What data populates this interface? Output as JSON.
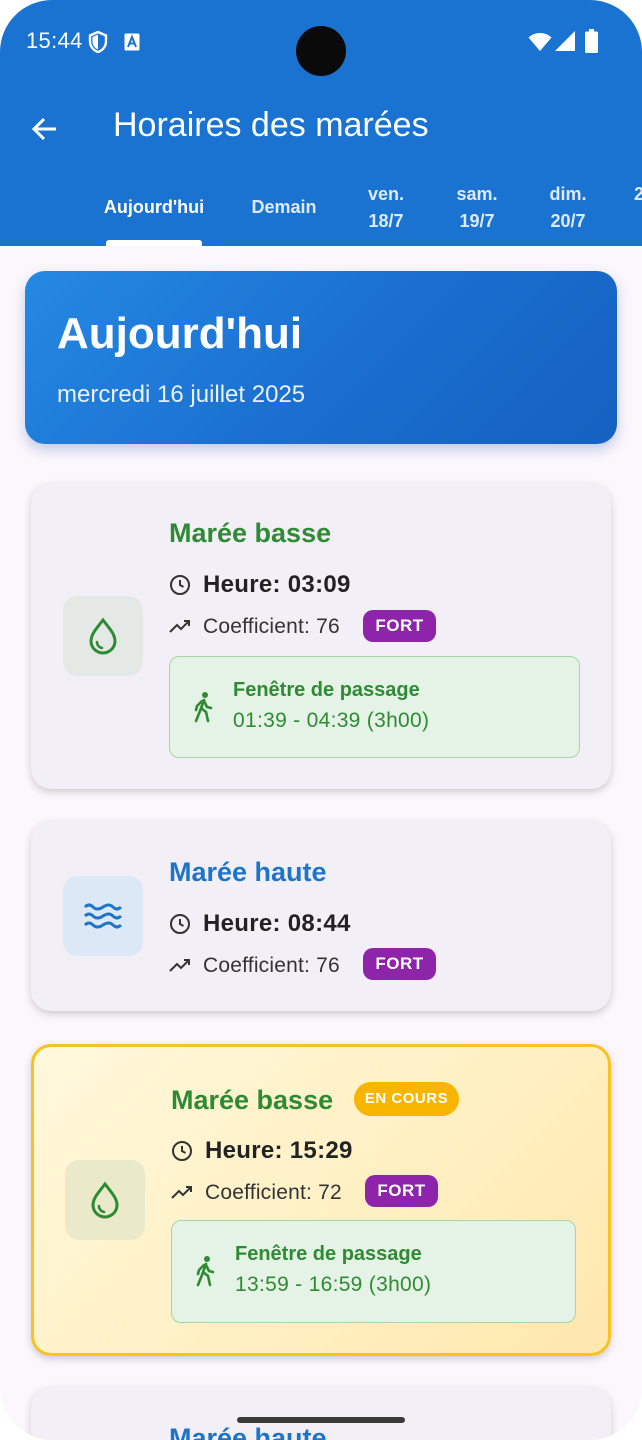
{
  "status_bar": {
    "time": "15:44"
  },
  "app_bar": {
    "title": "Horaires des marées"
  },
  "tabs": [
    {
      "line1": "Aujourd'hui",
      "line2": ""
    },
    {
      "line1": "Demain",
      "line2": ""
    },
    {
      "line1": "ven.",
      "line2": "18/7"
    },
    {
      "line1": "sam.",
      "line2": "19/7"
    },
    {
      "line1": "dim.",
      "line2": "20/7"
    },
    {
      "line1": "",
      "line2": "2"
    }
  ],
  "hero": {
    "title": "Aujourd'hui",
    "date": "mercredi 16 juillet 2025"
  },
  "tides": [
    {
      "title": "Marée basse",
      "heure": "Heure: 03:09",
      "coef": "Coefficient: 76",
      "badge": "FORT",
      "window_title": "Fenêtre de passage",
      "window_range": "01:39 - 04:39 (3h00)"
    },
    {
      "title": "Marée haute",
      "heure": "Heure: 08:44",
      "coef": "Coefficient: 76",
      "badge": "FORT"
    },
    {
      "title": "Marée basse",
      "status": "EN COURS",
      "heure": "Heure: 15:29",
      "coef": "Coefficient: 72",
      "badge": "FORT",
      "window_title": "Fenêtre de passage",
      "window_range": "13:59 - 16:59 (3h00)"
    },
    {
      "title": "Marée haute"
    }
  ],
  "colors": {
    "primary": "#1a73d0",
    "low_tide": "#2e8b34",
    "high_tide": "#1e74c9",
    "badge": "#8e24aa",
    "en_cours": "#f7b500"
  },
  "icons": {
    "back": "arrow-left-icon",
    "low_tide": "water-drop-icon",
    "high_tide": "waves-icon",
    "time": "clock-icon",
    "coefficient": "trending-up-icon",
    "window": "walking-person-icon"
  }
}
